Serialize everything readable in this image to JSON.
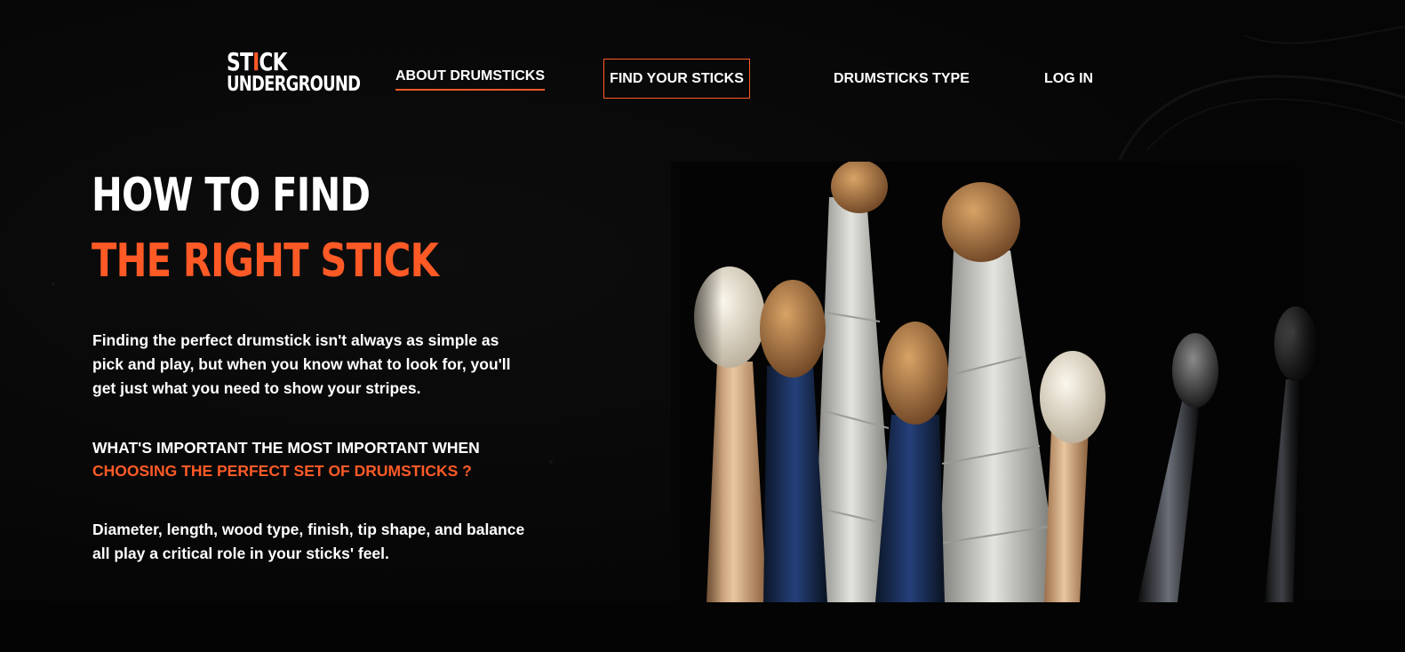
{
  "brand": {
    "logo_line1_prefix": "ST",
    "logo_line1_mark": "I",
    "logo_line1_suffix": "CK",
    "logo_line2": "UNDERGROUND"
  },
  "nav": {
    "about": "ABOUT DRUMSTICKS",
    "find": "FIND YOUR STICKS",
    "types": "DRUMSTICKS TYPE",
    "login": "LOG IN"
  },
  "hero": {
    "title_line1": "HOW TO FIND",
    "title_line2": "THE RIGHT STICK",
    "intro": "Finding the perfect drumstick isn't always as simple as pick and play, but when you know what to look for, you'll get just what you need to show your stripes.",
    "question_line1": "WHAT'S IMPORTANT THE MOST IMPORTANT WHEN",
    "question_line2": "CHOOSING THE PERFECT SET OF DRUMSTICKS ?",
    "answer": "Diameter, length, wood type, finish, tip shape, and balance all play a critical role in your sticks' feel."
  },
  "colors": {
    "accent": "#ff5a26",
    "background": "#050505",
    "text": "#ffffff"
  }
}
